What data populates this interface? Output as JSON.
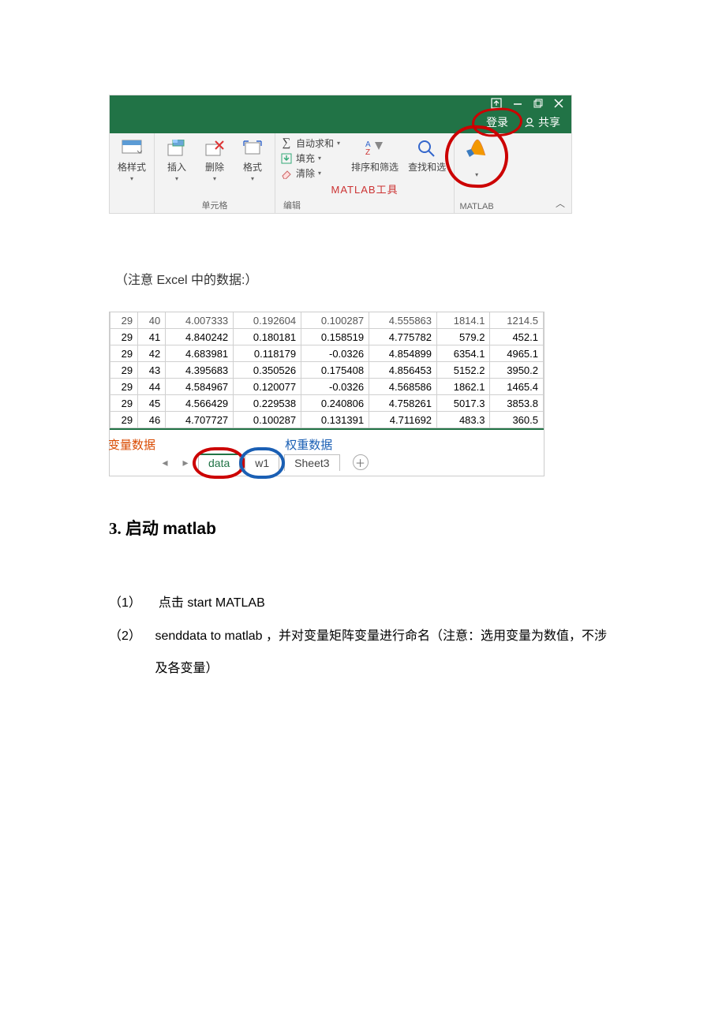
{
  "titlebar": {
    "login": "登录",
    "share": "共享"
  },
  "ribbon": {
    "styles": "格样式",
    "insert": "插入",
    "delete": "删除",
    "format": "格式",
    "cells_group": "单元格",
    "autosum": "自动求和",
    "fill": "填充",
    "clear": "清除",
    "sort_filter": "排序和筛选",
    "find_select": "查找和选",
    "matlab_tool": "MATLAB工具",
    "edit_group": "编辑",
    "matlab_group": "MATLAB"
  },
  "note": "（注意 Excel 中的数据:）",
  "table": {
    "rows": [
      [
        "29",
        "40",
        "4.007333",
        "0.192604",
        "0.100287",
        "4.555863",
        "1814.1",
        "1214.5"
      ],
      [
        "29",
        "41",
        "4.840242",
        "0.180181",
        "0.158519",
        "4.775782",
        "579.2",
        "452.1"
      ],
      [
        "29",
        "42",
        "4.683981",
        "0.118179",
        "-0.0326",
        "4.854899",
        "6354.1",
        "4965.1"
      ],
      [
        "29",
        "43",
        "4.395683",
        "0.350526",
        "0.175408",
        "4.856453",
        "5152.2",
        "3950.2"
      ],
      [
        "29",
        "44",
        "4.584967",
        "0.120077",
        "-0.0326",
        "4.568586",
        "1862.1",
        "1465.4"
      ],
      [
        "29",
        "45",
        "4.566429",
        "0.229538",
        "0.240806",
        "4.758261",
        "5017.3",
        "3853.8"
      ],
      [
        "29",
        "46",
        "4.707727",
        "0.100287",
        "0.131391",
        "4.711692",
        "483.3",
        "360.5"
      ]
    ]
  },
  "sheets": {
    "var_label": "变量数据",
    "weight_label": "权重数据",
    "data": "data",
    "w1": "w1",
    "sheet3": "Sheet3"
  },
  "section_title_cn": "3. 启动 ",
  "section_title_lat": "matlab",
  "steps": [
    {
      "n": "（1）",
      "t": "点击 start MATLAB"
    },
    {
      "n": "（2）",
      "t": "senddata to matlab ，并对变量矩阵变量进行命名（注意：选用变量为数值，不涉及各变量）"
    }
  ]
}
